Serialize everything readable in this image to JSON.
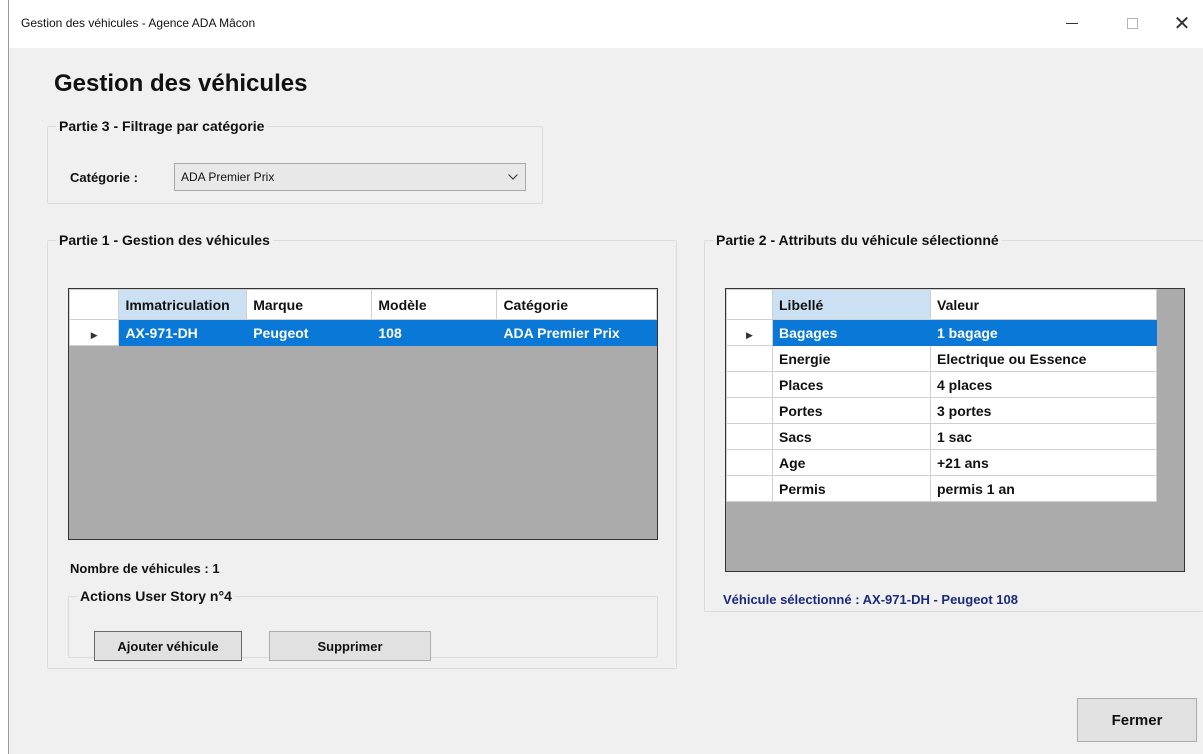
{
  "window": {
    "title": "Gestion des véhicules - Agence ADA Mâcon",
    "minimize_glyph": "—",
    "close_glyph": "✕"
  },
  "page_title": "Gestion des véhicules",
  "filter_group": {
    "legend": "Partie 3 - Filtrage par catégorie",
    "category_label": "Catégorie :",
    "category_value": "ADA Premier Prix"
  },
  "vehicles_group": {
    "legend": "Partie 1 - Gestion des véhicules",
    "columns": [
      "Immatriculation",
      "Marque",
      "Modèle",
      "Catégorie"
    ],
    "rows": [
      {
        "immat": "AX-971-DH",
        "marque": "Peugeot",
        "modele": "108",
        "categorie": "ADA Premier Prix"
      }
    ],
    "count_label": "Nombre de véhicules : 1",
    "actions": {
      "legend": "Actions User Story n°4",
      "add_label": "Ajouter véhicule",
      "delete_label": "Supprimer"
    }
  },
  "attributes_group": {
    "legend": "Partie 2 - Attributs du véhicule sélectionné",
    "columns": [
      "Libellé",
      "Valeur"
    ],
    "rows": [
      {
        "libelle": "Bagages",
        "valeur": "1 bagage"
      },
      {
        "libelle": "Energie",
        "valeur": "Electrique ou Essence"
      },
      {
        "libelle": "Places",
        "valeur": "4 places"
      },
      {
        "libelle": "Portes",
        "valeur": "3 portes"
      },
      {
        "libelle": "Sacs",
        "valeur": "1 sac"
      },
      {
        "libelle": "Age",
        "valeur": "+21 ans"
      },
      {
        "libelle": "Permis",
        "valeur": "permis 1 an"
      }
    ],
    "selected_label": "Véhicule sélectionné : AX-971-DH - Peugeot 108"
  },
  "close_button": "Fermer",
  "colors": {
    "selection": "#0a78d7",
    "sorted_header": "#cce0f4",
    "grid_background": "#ababab",
    "selected_label_text": "#1a2a7a"
  },
  "icons": {
    "row_indicator": "triangle-right-icon",
    "combo_arrow": "chevron-down-icon"
  }
}
